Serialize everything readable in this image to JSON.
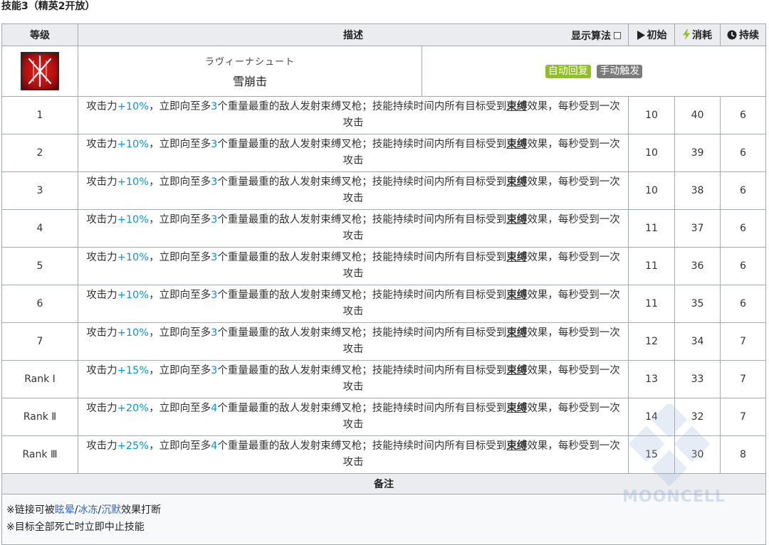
{
  "heading": "技能3（精英2开放）",
  "skill": {
    "icon": "skill-icon-red-cross",
    "name_jp": "ラヴィーナシュート",
    "name_cn": "雪崩击",
    "tags": [
      "自动回复",
      "手动触发"
    ]
  },
  "columns": {
    "level": "等级",
    "desc": "描述",
    "algo": "显示算法",
    "init": "初始",
    "cost": "消耗",
    "duration": "持续"
  },
  "rows": [
    {
      "level": "1",
      "atk": "+10%",
      "n": "3",
      "init": "10",
      "cost": "40",
      "dur": "6"
    },
    {
      "level": "2",
      "atk": "+10%",
      "n": "3",
      "init": "10",
      "cost": "39",
      "dur": "6"
    },
    {
      "level": "3",
      "atk": "+10%",
      "n": "3",
      "init": "10",
      "cost": "38",
      "dur": "6"
    },
    {
      "level": "4",
      "atk": "+10%",
      "n": "3",
      "init": "11",
      "cost": "37",
      "dur": "6"
    },
    {
      "level": "5",
      "atk": "+10%",
      "n": "3",
      "init": "11",
      "cost": "36",
      "dur": "6"
    },
    {
      "level": "6",
      "atk": "+10%",
      "n": "3",
      "init": "11",
      "cost": "35",
      "dur": "6"
    },
    {
      "level": "7",
      "atk": "+10%",
      "n": "3",
      "init": "12",
      "cost": "34",
      "dur": "7"
    },
    {
      "level": "Rank Ⅰ",
      "atk": "+15%",
      "n": "3",
      "init": "13",
      "cost": "33",
      "dur": "7"
    },
    {
      "level": "Rank Ⅱ",
      "atk": "+20%",
      "n": "4",
      "init": "14",
      "cost": "32",
      "dur": "7"
    },
    {
      "level": "Rank Ⅲ",
      "atk": "+25%",
      "n": "4",
      "init": "15",
      "cost": "30",
      "dur": "8"
    }
  ],
  "desc_parts": {
    "p1": "攻击力",
    "p2": "，立即向至多",
    "p3": "个重量最重的敌人发射束缚叉枪；技能持续时间内所有目标受到",
    "kw": "束缚",
    "p4": "效果，每秒受到一次攻击"
  },
  "remarks": {
    "title": "备注",
    "line1_prefix": "※链接可被",
    "links": [
      "眩晕",
      "冰冻",
      "沉默"
    ],
    "sep": "/",
    "line1_suffix": "效果打断",
    "line2": "※目标全部死亡时立即中止技能"
  },
  "watermark": "MOONCELL",
  "colors": {
    "accent_blue": "#0098dc",
    "tag_auto": "#8ec31f",
    "tag_manual": "#7b7b7b",
    "link": "#3366cc"
  }
}
